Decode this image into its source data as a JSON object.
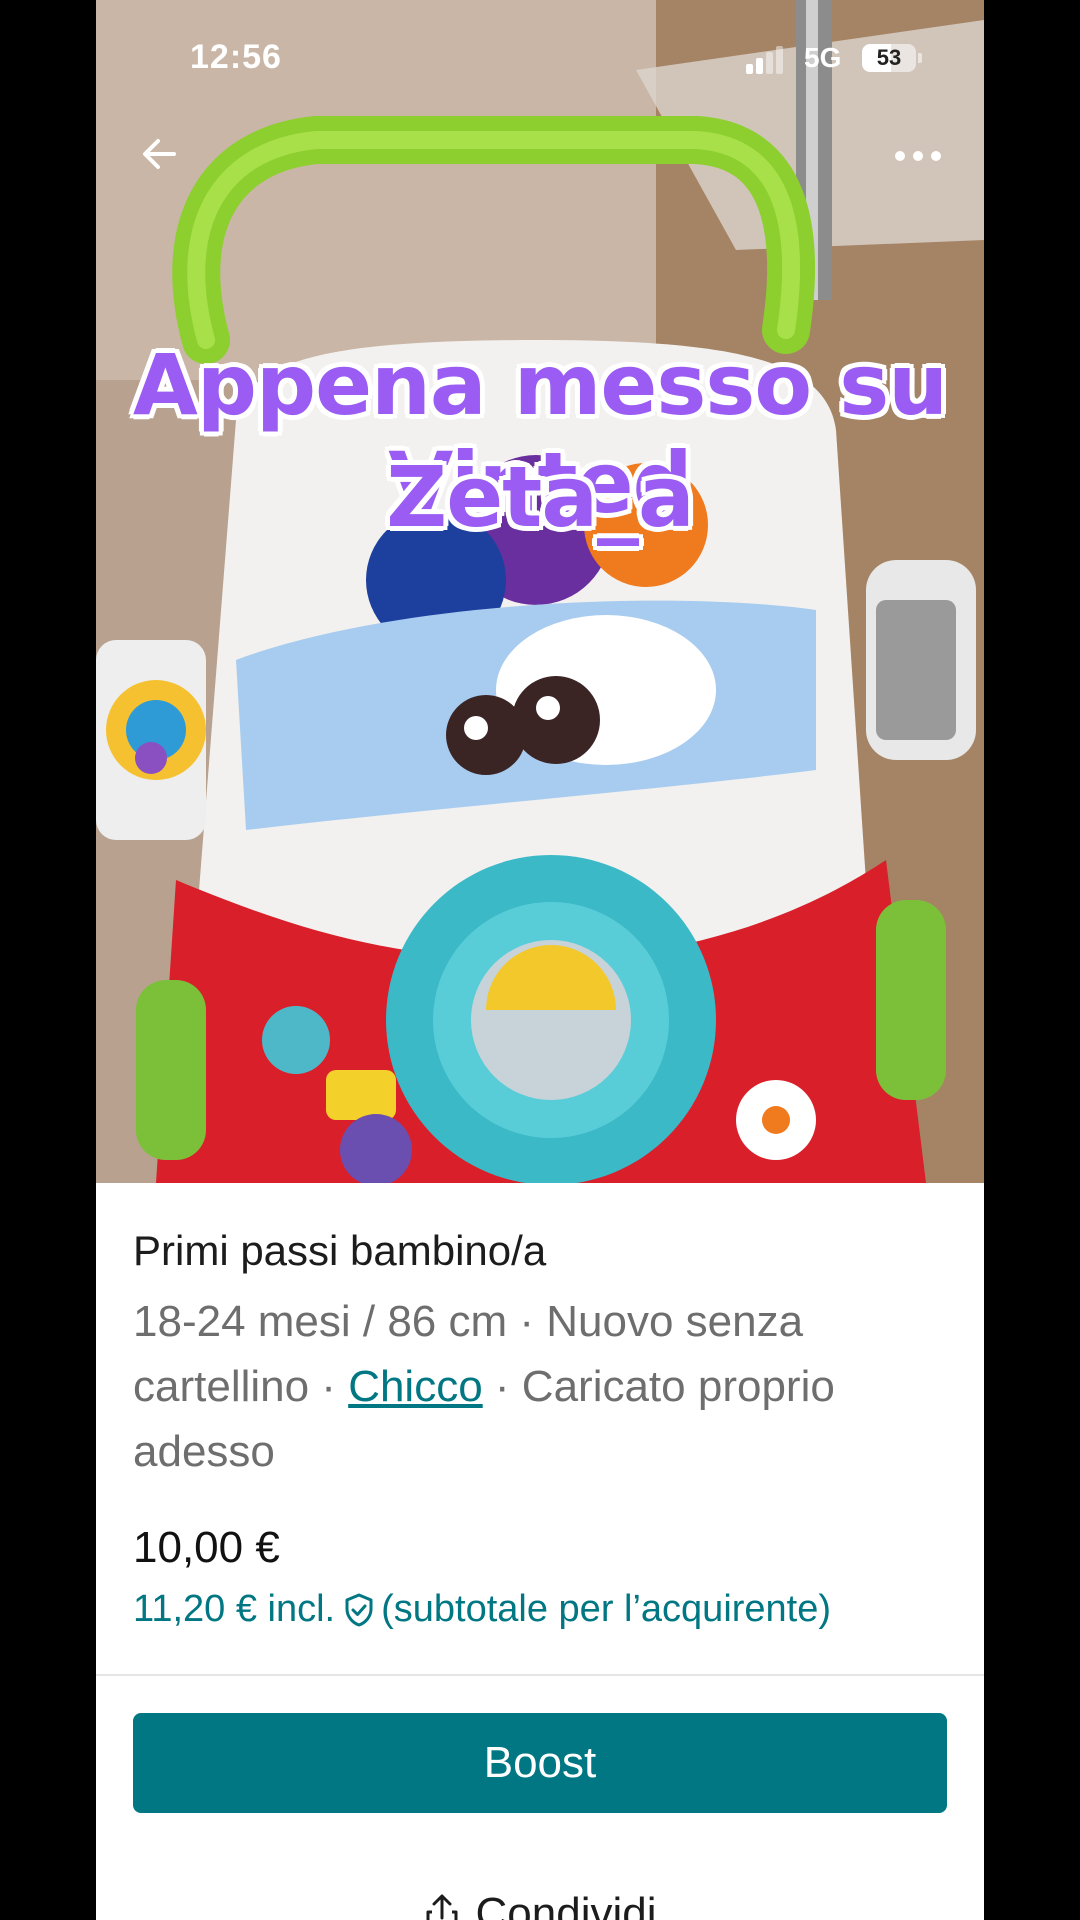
{
  "status_bar": {
    "time": "12:56",
    "network": "5G",
    "battery": "53",
    "battery_level_percent": 53
  },
  "header": {
    "back_icon": "arrow-left-icon",
    "more_icon": "more-horizontal-icon"
  },
  "overlay_caption": {
    "line1": "Appena messo su Vinted",
    "line2": "Zeta_a"
  },
  "listing": {
    "title": "Primi passi bambino/a",
    "meta_before_brand": "18-24 mesi / 86 cm · Nuovo senza cartellino · ",
    "brand": "Chicco",
    "meta_after_brand": " · Caricato proprio adesso",
    "price": "10,00 €",
    "price_incl": "11,20 € incl.",
    "price_incl_note": "(subtotale per l’acquirente)",
    "protection_icon": "shield-check-icon"
  },
  "actions": {
    "boost_label": "Boost",
    "share_label": "Condividi",
    "share_icon": "share-icon"
  },
  "colors": {
    "accent": "#007782",
    "caption_purple": "#9a5cf2"
  }
}
